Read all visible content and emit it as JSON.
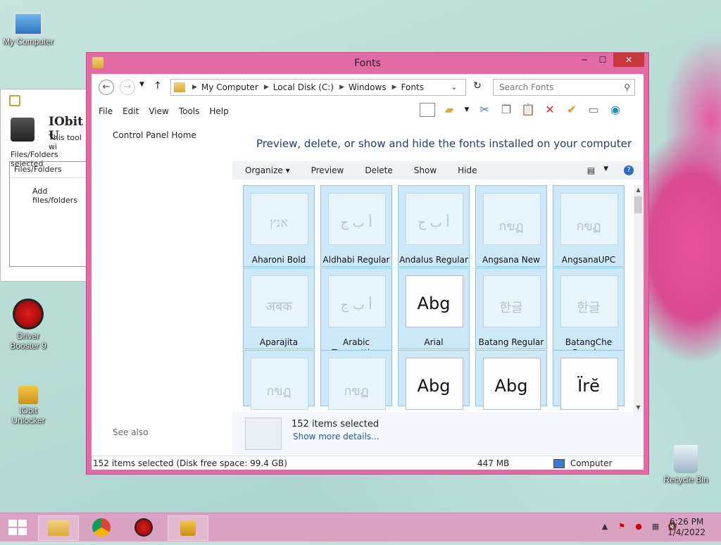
{
  "desktop": {
    "icons": [
      {
        "label": "My Computer"
      },
      {
        "label": "Driver Booster 9"
      },
      {
        "label": "IObit Unlocker"
      },
      {
        "label": "Recycle Bin"
      }
    ]
  },
  "iobit_window": {
    "title": "IObit U",
    "subtitle": "This tool wi",
    "selected_label": "Files/Folders selected",
    "column_header": "Files/Folders",
    "add_hint": "Add files/folders"
  },
  "window": {
    "title": "Fonts",
    "min_glyph": "─",
    "max_glyph": "☐",
    "close_glyph": "✕",
    "breadcrumb": [
      "My Computer",
      "Local Disk (C:)",
      "Windows",
      "Fonts"
    ],
    "search_placeholder": "Search Fonts",
    "menu": [
      "File",
      "Edit",
      "View",
      "Tools",
      "Help"
    ],
    "left_pane": {
      "home": "Control Panel Home",
      "see_also": "See also"
    },
    "heading": "Preview, delete, or show and hide the fonts installed on your computer",
    "commands": [
      "Organize ▾",
      "Preview",
      "Delete",
      "Show",
      "Hide"
    ],
    "fonts": [
      {
        "name": "Aharoni Bold",
        "glyph": "אנץ",
        "style": "light"
      },
      {
        "name": "Aldhabi Regular",
        "glyph": "أ ب ج",
        "style": "light"
      },
      {
        "name": "Andalus Regular",
        "glyph": "أ ب ج",
        "style": "light"
      },
      {
        "name": "Angsana New",
        "glyph": "กขฏ",
        "style": "light"
      },
      {
        "name": "AngsanaUPC",
        "glyph": "กขฏ",
        "style": "light"
      },
      {
        "name": "Aparajita",
        "glyph": "अबक",
        "style": "light"
      },
      {
        "name": "Arabic Typesetting Regular",
        "glyph": "أ ب ج",
        "style": "light"
      },
      {
        "name": "Arial",
        "glyph": "Abg",
        "style": "dark"
      },
      {
        "name": "Batang Regular",
        "glyph": "한글",
        "style": "light"
      },
      {
        "name": "BatangChe Regular",
        "glyph": "한글",
        "style": "light"
      },
      {
        "name": "",
        "glyph": "กขฏ",
        "style": "light"
      },
      {
        "name": "",
        "glyph": "กขฏ",
        "style": "light"
      },
      {
        "name": "",
        "glyph": "Abg",
        "style": "dark"
      },
      {
        "name": "",
        "glyph": "Abg",
        "style": "dark"
      },
      {
        "name": "",
        "glyph": "Ïrĕ",
        "style": "dark"
      }
    ],
    "details": {
      "count": "152 items selected",
      "more": "Show more details..."
    },
    "status": {
      "selection": "152 items selected (Disk free space: 99.4 GB)",
      "size": "447 MB",
      "location": "Computer"
    }
  },
  "taskbar": {
    "clock_time": "6:26 PM",
    "clock_date": "1/4/2022"
  }
}
